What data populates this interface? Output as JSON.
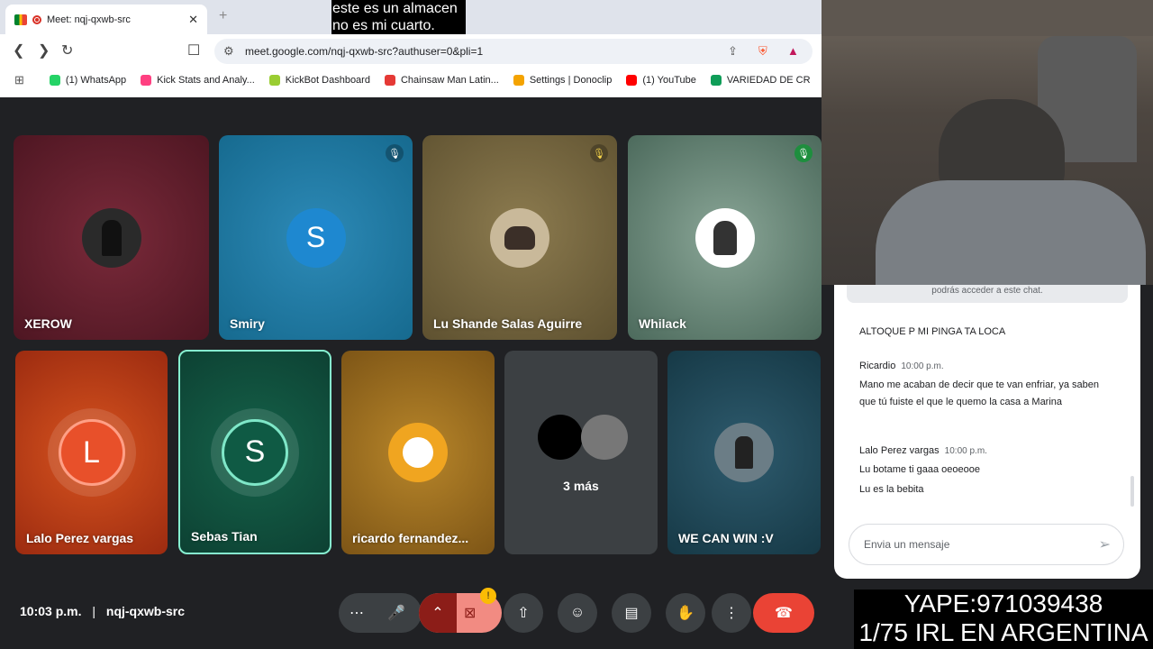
{
  "browser": {
    "tab_title": "Meet: nqj-qxwb-src",
    "caption": "este es un almacen no es mi cuarto.",
    "url": "meet.google.com/nqj-qxwb-src?authuser=0&pli=1",
    "bookmarks": [
      {
        "label": "(1) WhatsApp",
        "color": "#25d366"
      },
      {
        "label": "Kick Stats and Analy...",
        "color": "#ff4081"
      },
      {
        "label": "KickBot Dashboard",
        "color": "#9acd32"
      },
      {
        "label": "Chainsaw Man Latin...",
        "color": "#e53935"
      },
      {
        "label": "Settings | Donoclip",
        "color": "#f4a300"
      },
      {
        "label": "(1) YouTube",
        "color": "#ff0000"
      },
      {
        "label": "VARIEDAD DE CR",
        "color": "#0f9d58"
      }
    ]
  },
  "participants": [
    {
      "name": "XEROW"
    },
    {
      "name": "Smiry",
      "initial": "S"
    },
    {
      "name": "Lu Shande Salas Aguirre"
    },
    {
      "name": "Whilack"
    },
    {
      "name": "Lalo Perez vargas",
      "initial": "L"
    },
    {
      "name": "Sebas Tian",
      "initial": "S"
    },
    {
      "name": "ricardo fernandez..."
    },
    {
      "name": "3 más"
    },
    {
      "name": "WE CAN WIN :V"
    }
  ],
  "footer": {
    "time": "10:03 p.m.",
    "meeting_code": "nqj-qxwb-src"
  },
  "chat": {
    "notice": "podrás acceder a este chat.",
    "messages": [
      {
        "text": "ALTOQUE P MI PINGA TA LOCA"
      },
      {
        "sender": "Ricardio",
        "time": "10:00 p.m.",
        "text": "Mano me acaban de decir que te van enfriar, ya saben que tú fuiste el que le quemo la casa a Marina"
      },
      {
        "sender": "Lalo Perez vargas",
        "time": "10:00 p.m.",
        "text1": "Lu botame ti gaaa oeoeooe",
        "text2": "Lu es la bebita"
      }
    ],
    "placeholder": "Envia un mensaje"
  },
  "overlay": {
    "line1": "YAPE:971039438",
    "line2": "1/75 IRL EN ARGENTINA"
  }
}
